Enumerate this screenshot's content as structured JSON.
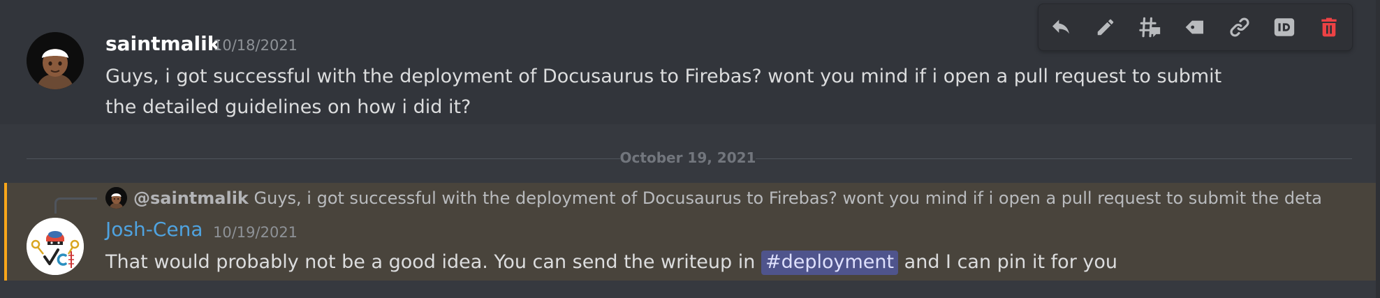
{
  "colors": {
    "background": "#36393f",
    "hover_background": "#32353b",
    "mention_highlight": "#49443c",
    "mention_bar": "#faa61a",
    "username_blue": "#4fa3e0",
    "delete_red": "#ed4245",
    "channel_mention_bg": "#4f548c"
  },
  "toolbar": {
    "icons": [
      "reply-icon",
      "edit-pencil-icon",
      "create-thread-icon",
      "tag-icon",
      "copy-link-icon",
      "copy-id-icon",
      "delete-trash-icon"
    ]
  },
  "message1": {
    "author": "saintmalik",
    "timestamp": "10/18/2021",
    "text": "Guys, i got successful with the deployment of Docusaurus to Firebas? wont you mind if i open a pull request to submit the detailed guidelines on how i did it?"
  },
  "date_divider": {
    "label": "October 19, 2021"
  },
  "message2": {
    "reply": {
      "user": "@saintmalik",
      "text": "Guys, i got successful with the deployment of Docusaurus to Firebas? wont you mind if i open a pull request to submit the detaile…"
    },
    "author": "Josh-Cena",
    "timestamp": "10/19/2021",
    "text_before": "That would probably not be a good idea. You can send the writeup in ",
    "channel_mention": "#deployment",
    "text_after": " and I can pin it for you"
  }
}
